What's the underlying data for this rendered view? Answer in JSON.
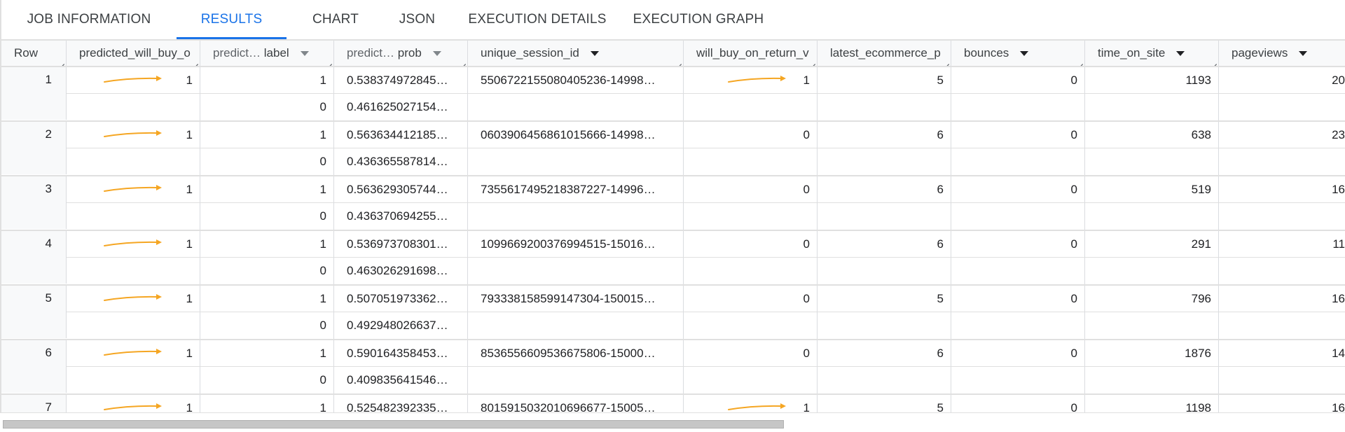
{
  "tabs": [
    {
      "label": "JOB INFORMATION",
      "active": false
    },
    {
      "label": "RESULTS",
      "active": true
    },
    {
      "label": "CHART",
      "active": false
    },
    {
      "label": "JSON",
      "active": false
    },
    {
      "label": "EXECUTION DETAILS",
      "active": false
    },
    {
      "label": "EXECUTION GRAPH",
      "active": false
    }
  ],
  "columns": [
    {
      "label": "Row",
      "prefix": "",
      "sortable": false
    },
    {
      "label": "predicted_will_buy_o",
      "prefix": "",
      "sortable": false
    },
    {
      "label": "label",
      "prefix": "predict…",
      "sortable": true
    },
    {
      "label": "prob",
      "prefix": "predict…",
      "sortable": true
    },
    {
      "label": "unique_session_id",
      "prefix": "",
      "sortable": true
    },
    {
      "label": "will_buy_on_return_v",
      "prefix": "",
      "sortable": false
    },
    {
      "label": "latest_ecommerce_p",
      "prefix": "",
      "sortable": false
    },
    {
      "label": "bounces",
      "prefix": "",
      "sortable": true
    },
    {
      "label": "time_on_site",
      "prefix": "",
      "sortable": true
    },
    {
      "label": "pageviews",
      "prefix": "",
      "sortable": true
    }
  ],
  "accent_color": "#1a73e8",
  "arrow_color": "#f5a623",
  "rows": [
    {
      "row": "1",
      "predicted": "1",
      "probs": [
        {
          "label": "1",
          "prob": "0.538374972845…"
        },
        {
          "label": "0",
          "prob": "0.461625027154…"
        }
      ],
      "session_id": "5506722155080405236-14998…",
      "will_buy": "1",
      "will_buy_arrow": true,
      "latest": "5",
      "bounces": "0",
      "time_on_site": "1193",
      "pageviews": "20"
    },
    {
      "row": "2",
      "predicted": "1",
      "probs": [
        {
          "label": "1",
          "prob": "0.563634412185…"
        },
        {
          "label": "0",
          "prob": "0.436365587814…"
        }
      ],
      "session_id": "0603906456861015666-14998…",
      "will_buy": "0",
      "will_buy_arrow": false,
      "latest": "6",
      "bounces": "0",
      "time_on_site": "638",
      "pageviews": "23"
    },
    {
      "row": "3",
      "predicted": "1",
      "probs": [
        {
          "label": "1",
          "prob": "0.563629305744…"
        },
        {
          "label": "0",
          "prob": "0.436370694255…"
        }
      ],
      "session_id": "7355617495218387227-14996…",
      "will_buy": "0",
      "will_buy_arrow": false,
      "latest": "6",
      "bounces": "0",
      "time_on_site": "519",
      "pageviews": "16"
    },
    {
      "row": "4",
      "predicted": "1",
      "probs": [
        {
          "label": "1",
          "prob": "0.536973708301…"
        },
        {
          "label": "0",
          "prob": "0.463026291698…"
        }
      ],
      "session_id": "1099669200376994515-15016…",
      "will_buy": "0",
      "will_buy_arrow": false,
      "latest": "6",
      "bounces": "0",
      "time_on_site": "291",
      "pageviews": "11"
    },
    {
      "row": "5",
      "predicted": "1",
      "probs": [
        {
          "label": "1",
          "prob": "0.507051973362…"
        },
        {
          "label": "0",
          "prob": "0.492948026637…"
        }
      ],
      "session_id": "793338158599147304-150015…",
      "will_buy": "0",
      "will_buy_arrow": false,
      "latest": "5",
      "bounces": "0",
      "time_on_site": "796",
      "pageviews": "16"
    },
    {
      "row": "6",
      "predicted": "1",
      "probs": [
        {
          "label": "1",
          "prob": "0.590164358453…"
        },
        {
          "label": "0",
          "prob": "0.409835641546…"
        }
      ],
      "session_id": "8536556609536675806-15000…",
      "will_buy": "0",
      "will_buy_arrow": false,
      "latest": "6",
      "bounces": "0",
      "time_on_site": "1876",
      "pageviews": "14"
    },
    {
      "row": "7",
      "predicted": "1",
      "probs": [
        {
          "label": "1",
          "prob": "0.525482392335…"
        }
      ],
      "session_id": "8015915032010696677-15005…",
      "will_buy": "1",
      "will_buy_arrow": true,
      "latest": "5",
      "bounces": "0",
      "time_on_site": "1198",
      "pageviews": "16"
    }
  ]
}
